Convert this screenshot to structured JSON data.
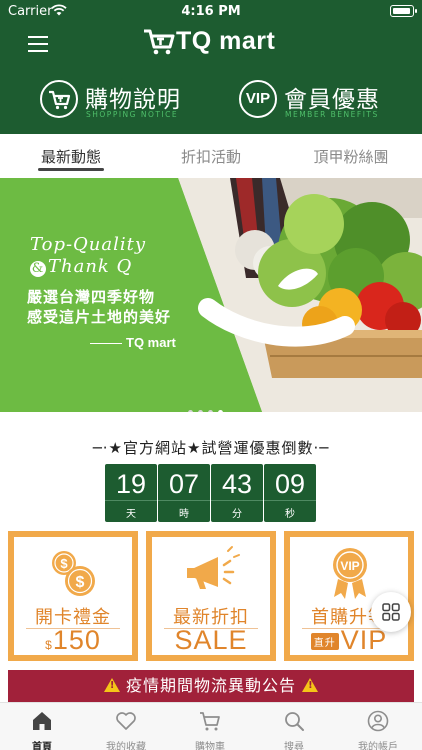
{
  "status_bar": {
    "carrier": "Carrier",
    "time": "4:16 PM"
  },
  "header": {
    "logo_text": "TQ mart",
    "shopping": {
      "title": "購物說明",
      "subtitle": "SHOPPING NOTICE"
    },
    "vip": {
      "badge": "VIP",
      "title": "會員優惠",
      "subtitle": "MEMBER BENEFITS"
    }
  },
  "tabs": [
    {
      "label": "最新動態",
      "active": true
    },
    {
      "label": "折扣活動",
      "active": false
    },
    {
      "label": "頂甲粉絲團",
      "active": false
    }
  ],
  "banner": {
    "line1": "Top-Quality",
    "amp": "&",
    "line2": "Thank Q",
    "slogan1": "嚴選台灣四季好物",
    "slogan2": "感受這片土地的美好",
    "brand": "TQ mart",
    "page_count": 4,
    "active_page": 4
  },
  "countdown": {
    "title": "─·★官方網站★試營運優惠倒數·─",
    "units": [
      {
        "value": "19",
        "label": "天"
      },
      {
        "value": "07",
        "label": "時"
      },
      {
        "value": "43",
        "label": "分"
      },
      {
        "value": "09",
        "label": "秒"
      }
    ]
  },
  "promos": [
    {
      "title": "開卡禮金",
      "prefix": "$",
      "big": "150"
    },
    {
      "title": "最新折扣",
      "big": "SALE"
    },
    {
      "title": "首購升等",
      "prefix": "直升",
      "big": "VIP"
    }
  ],
  "notice": {
    "text": "疫情期間物流異動公告"
  },
  "tabbar": [
    {
      "label": "首頁",
      "icon": "home-icon",
      "active": true
    },
    {
      "label": "我的收藏",
      "icon": "heart-icon",
      "active": false
    },
    {
      "label": "購物車",
      "icon": "cart-icon",
      "active": false
    },
    {
      "label": "搜尋",
      "icon": "search-icon",
      "active": false
    },
    {
      "label": "我的帳戶",
      "icon": "account-icon",
      "active": false
    }
  ],
  "colors": {
    "brand_green": "#1d5c30",
    "accent_green": "#4fbf6a",
    "banner_green": "#6dbb43",
    "orange": "#f1a94a",
    "notice_red": "#a1213a"
  }
}
